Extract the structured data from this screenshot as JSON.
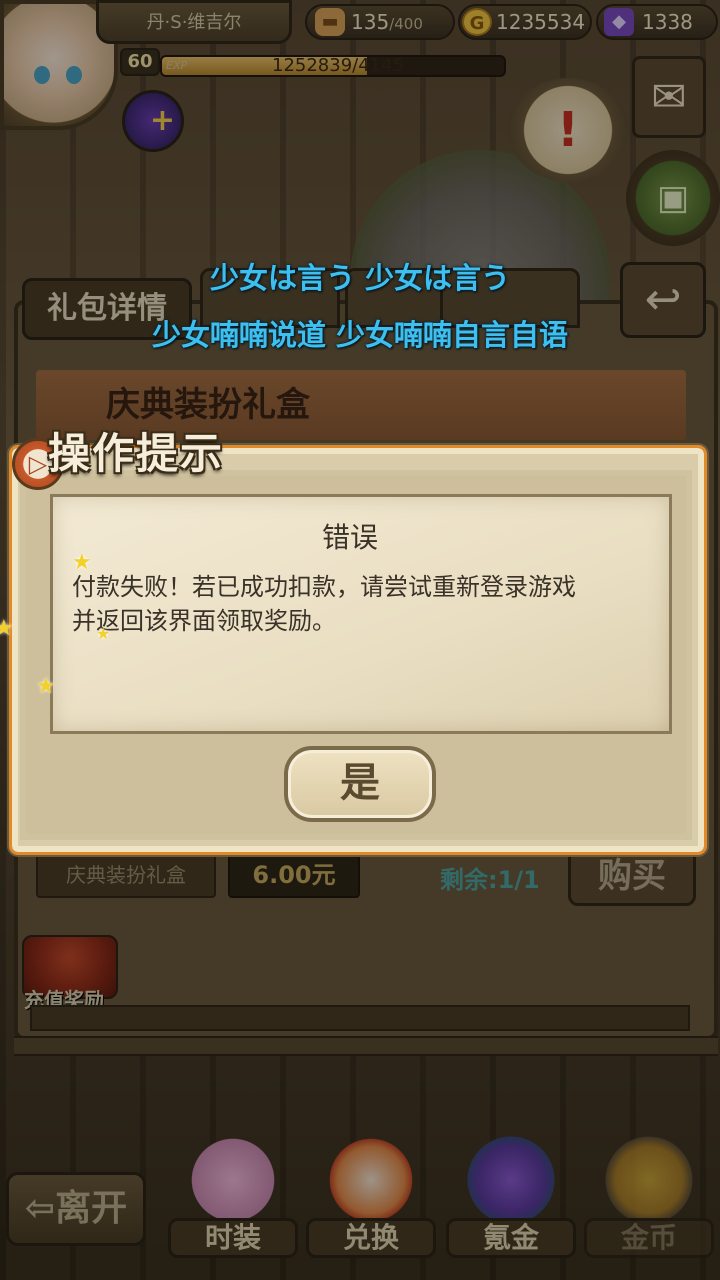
{
  "player": {
    "name": "丹·S·维吉尔",
    "level": "60",
    "exp_label": "EXP",
    "exp_text": "1252839/4145",
    "exp_progress": 0.6
  },
  "resources": {
    "bread": "135",
    "bread_max": "/400",
    "gold": "1235534",
    "gem": "1338"
  },
  "subtitles": {
    "line1": "少女は言う 少女は言う",
    "line2": "少女喃喃说道 少女喃喃自言自语"
  },
  "gift_panel": {
    "title": "礼包详情",
    "header": "庆典装扮礼盒",
    "item_name": "庆典装扮礼盒",
    "price": "6.00元",
    "remaining": "剩余:1/1",
    "buy_label": "购买",
    "recharge_label": "充值奖励"
  },
  "dialog": {
    "title": "操作提示",
    "heading": "错误",
    "message_line1": "付款失败！若已成功扣款，请尝试重新登录游戏",
    "message_line2": "并返回该界面领取奖励。",
    "confirm_label": "是"
  },
  "bottom_nav": {
    "leave_label": "⇦离开",
    "items": [
      {
        "label": "时装"
      },
      {
        "label": "兑换"
      },
      {
        "label": "氪金"
      },
      {
        "label": "金币"
      }
    ]
  },
  "icons": {
    "bread": "bread-icon",
    "gold": "gold-coin-icon",
    "gem": "purple-gem-icon",
    "mail": "envelope-icon",
    "quest": "scroll-icon",
    "bag": "backpack-icon",
    "back": "return-arrow-icon"
  },
  "colors": {
    "subtitle": "#3dc0f0",
    "dialog_border": "#e08a2a",
    "dialog_paper": "#f3ead4"
  }
}
